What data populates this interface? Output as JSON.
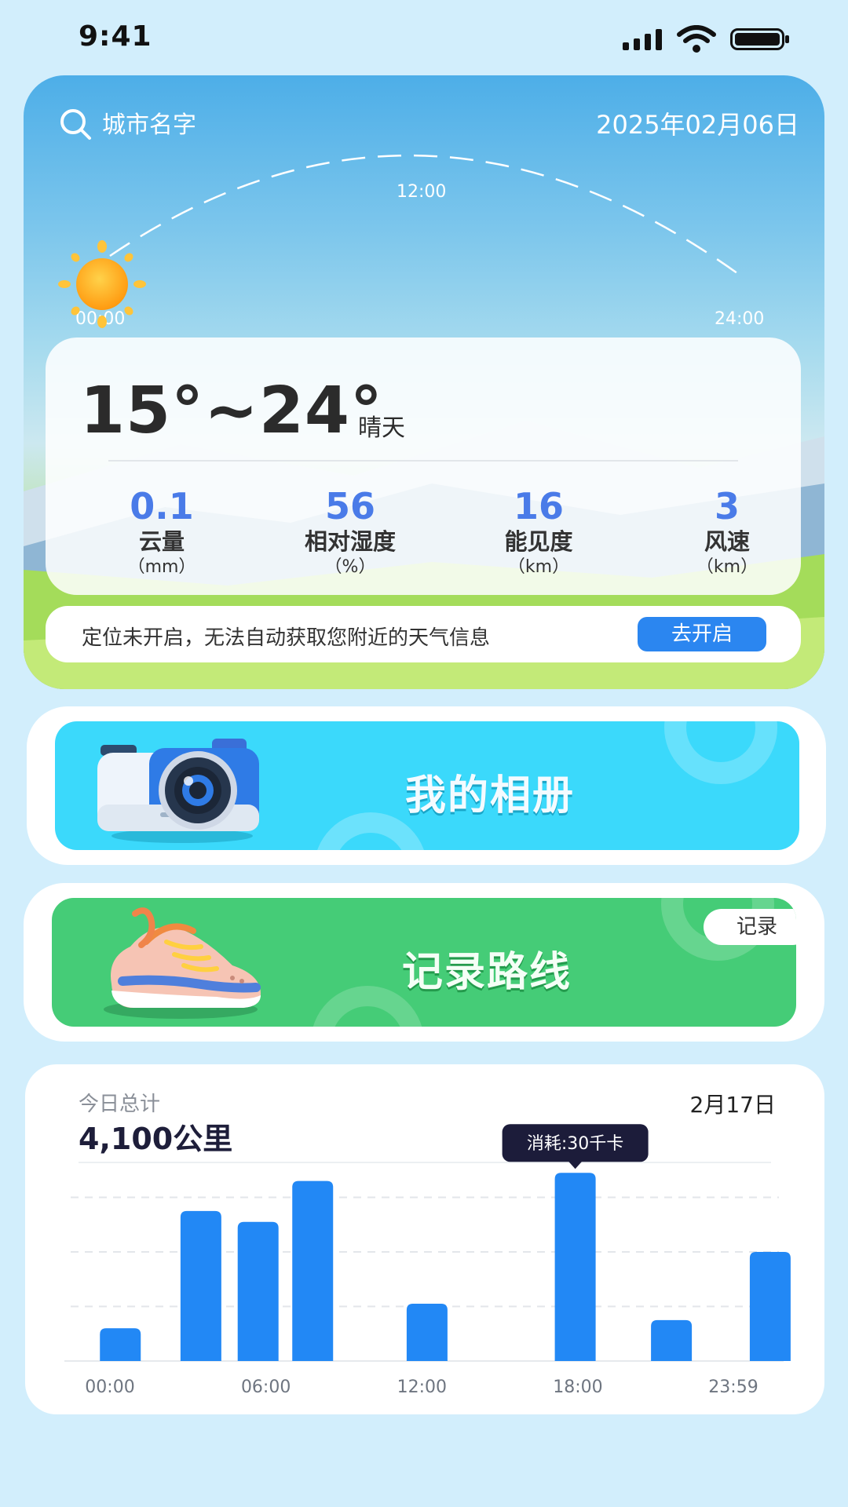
{
  "status_bar": {
    "time": "9:41"
  },
  "weather": {
    "city_placeholder": "城市名字",
    "date": "2025年02月06日",
    "sun_arc": {
      "start_label": "00:00",
      "noon_label": "12:00",
      "end_label": "24:00"
    },
    "temperature": "15°~24°",
    "condition": "晴天",
    "stats": [
      {
        "value": "0.1",
        "name": "云量",
        "unit": "（mm）"
      },
      {
        "value": "56",
        "name": "相对湿度",
        "unit": "（%）"
      },
      {
        "value": "16",
        "name": "能见度",
        "unit": "（km）"
      },
      {
        "value": "3",
        "name": "风速",
        "unit": "（km）"
      }
    ],
    "location_notice": "定位未开启，无法自动获取您附近的天气信息",
    "location_button": "去开启"
  },
  "album": {
    "title": "我的相册"
  },
  "route": {
    "title": "记录路线",
    "record_button": "记录"
  },
  "daily_stats": {
    "label": "今日总计",
    "total": "4,100公里",
    "date": "2月17日",
    "tooltip": "消耗:30千卡",
    "colors": {
      "bar": "#2288f5",
      "tooltip_bg": "#1c1c3a"
    }
  },
  "chart_data": {
    "type": "bar",
    "x_tick_labels": [
      "00:00",
      "06:00",
      "12:00",
      "18:00",
      "23:59"
    ],
    "x_hours": [
      0.4,
      3.5,
      5.7,
      7.8,
      12.2,
      17.9,
      21.6,
      25.4
    ],
    "values": [
      12,
      55,
      51,
      66,
      21,
      69,
      15,
      40
    ],
    "ylim": [
      0,
      80
    ],
    "grid": true,
    "highlighted_index": 5
  }
}
